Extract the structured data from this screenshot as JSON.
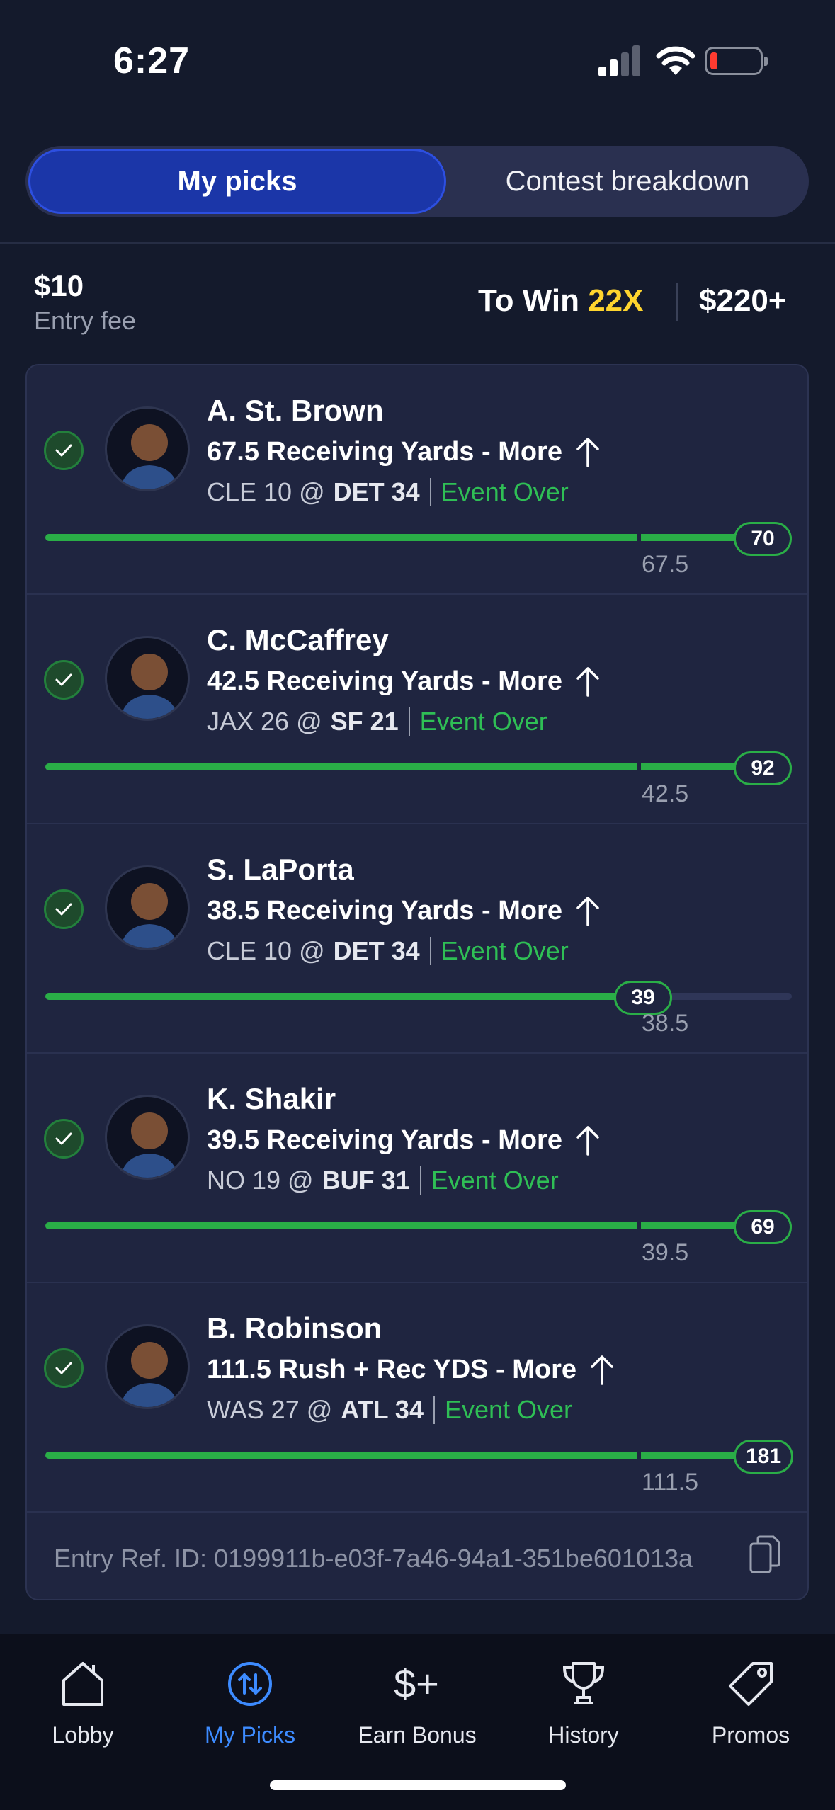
{
  "status_bar": {
    "time": "6:27"
  },
  "tabs": {
    "active": "My picks",
    "inactive": "Contest breakdown"
  },
  "entry": {
    "fee_value": "$10",
    "fee_label": "Entry fee",
    "to_win_label": "To Win",
    "multiplier": "22X",
    "payout": "$220+"
  },
  "picks": [
    {
      "name": "A. St. Brown",
      "line": "67.5 Receiving Yards - More",
      "away": "CLE 10 @",
      "home": "DET 34",
      "status": "Event Over",
      "actual": "70",
      "target": "67.5",
      "progress": 1.0
    },
    {
      "name": "C. McCaffrey",
      "line": "42.5 Receiving Yards - More",
      "away": "JAX 26 @",
      "home": "SF 21",
      "status": "Event Over",
      "actual": "92",
      "target": "42.5",
      "progress": 1.0
    },
    {
      "name": "S. LaPorta",
      "line": "38.5 Receiving Yards - More",
      "away": "CLE 10 @",
      "home": "DET 34",
      "status": "Event Over",
      "actual": "39",
      "target": "38.5",
      "progress": 0.84
    },
    {
      "name": "K. Shakir",
      "line": "39.5 Receiving Yards - More",
      "away": "NO 19 @",
      "home": "BUF 31",
      "status": "Event Over",
      "actual": "69",
      "target": "39.5",
      "progress": 1.0
    },
    {
      "name": "B. Robinson",
      "line": "111.5 Rush + Rec YDS - More",
      "away": "WAS 27 @",
      "home": "ATL 34",
      "status": "Event Over",
      "actual": "181",
      "target": "111.5",
      "progress": 1.0
    }
  ],
  "entry_ref": "Entry Ref. ID: 0199911b-e03f-7a46-94a1-351be601013a",
  "nav": [
    {
      "label": "Lobby",
      "icon": "home-icon"
    },
    {
      "label": "My Picks",
      "icon": "swap-circle-icon"
    },
    {
      "label": "Earn Bonus",
      "icon": "dollar-plus-icon"
    },
    {
      "label": "History",
      "icon": "trophy-icon"
    },
    {
      "label": "Promos",
      "icon": "tag-icon"
    }
  ],
  "colors": {
    "accent_blue": "#1b36a8",
    "success_green": "#2aae47",
    "multiplier_yellow": "#ffd52e",
    "background": "#141a2c"
  }
}
